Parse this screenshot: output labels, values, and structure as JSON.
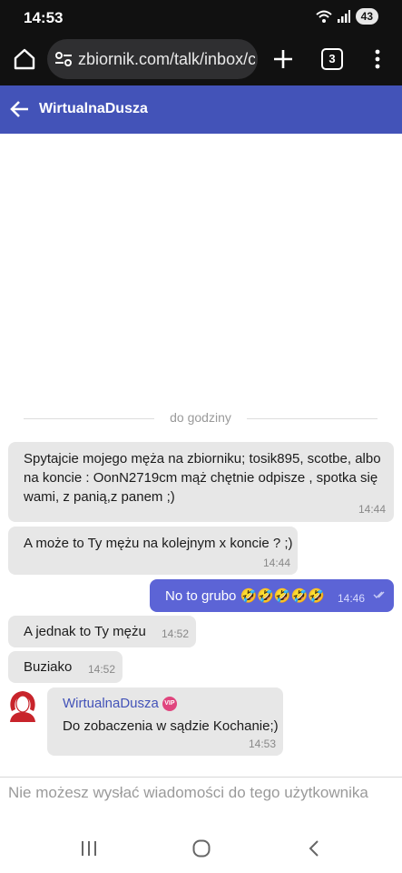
{
  "status_bar": {
    "time": "14:53",
    "battery": "43"
  },
  "browser": {
    "url": "zbiornik.com/talk/inbox/c",
    "tab_count": "3"
  },
  "header": {
    "title": "WirtualnaDusza"
  },
  "chat": {
    "date_separator": "do godziny",
    "messages": [
      {
        "direction": "in",
        "lines": [
          "Spytajcie mojego męża na zbiorniku; tosik895, scotbe, albo",
          "na koncie : OonN2719cm mąż chętnie odpisze , spotka się",
          "wami, z panią,z panem ;)"
        ],
        "time": "14:44"
      },
      {
        "direction": "in",
        "lines": [
          "A może to Ty mężu na kolejnym x koncie ? ;)"
        ],
        "time": "14:44"
      },
      {
        "direction": "out",
        "lines": [
          "No to grubo 🤣🤣🤣🤣🤣"
        ],
        "time": "14:46"
      },
      {
        "direction": "in",
        "lines": [
          "A jednak to Ty mężu"
        ],
        "time": "14:52"
      },
      {
        "direction": "in",
        "lines": [
          "Buziako"
        ],
        "time": "14:52"
      },
      {
        "direction": "in",
        "sender": "WirtualnaDusza",
        "badge": "VIP",
        "lines": [
          "Do zobaczenia w sądzie Kochanie;)"
        ],
        "time": "14:53"
      }
    ]
  },
  "footer": {
    "notice": "Nie możesz wysłać wiadomości do tego użytkownika"
  },
  "colors": {
    "header": "#4353b8",
    "outgoing_bubble": "#5c64d6",
    "incoming_bubble": "#e7e7e7",
    "vip_badge": "#e0457e"
  },
  "icons": [
    "home-icon",
    "tune-icon",
    "plus-icon",
    "menu-icon",
    "back-arrow-icon",
    "avatar-icon",
    "double-check-icon",
    "recents-icon",
    "nav-home-icon",
    "nav-back-icon"
  ]
}
